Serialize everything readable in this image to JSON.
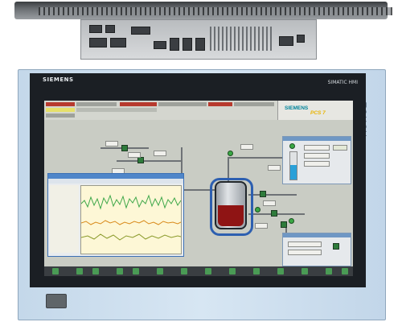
{
  "device": {
    "brand": "SIEMENS",
    "model_label": "SIMATIC HMI",
    "touch_label": "TOUCH"
  },
  "hmi": {
    "header_brand": "SIEMENS",
    "header_product": "PCS 7"
  },
  "colors": {
    "bezel": "#c4d8ea",
    "screen": "#1b1f24",
    "alarm_red": "#b73a2e",
    "reactor_liquid": "#8f1414",
    "jacket_blue": "#2d5fb0",
    "valve_green": "#2e7b3b",
    "trend_green": "#3fa84a",
    "trend_orange": "#d98a1a"
  },
  "icons": [
    "usb-port-icon",
    "valve-icon",
    "reactor-icon",
    "pump-icon"
  ]
}
